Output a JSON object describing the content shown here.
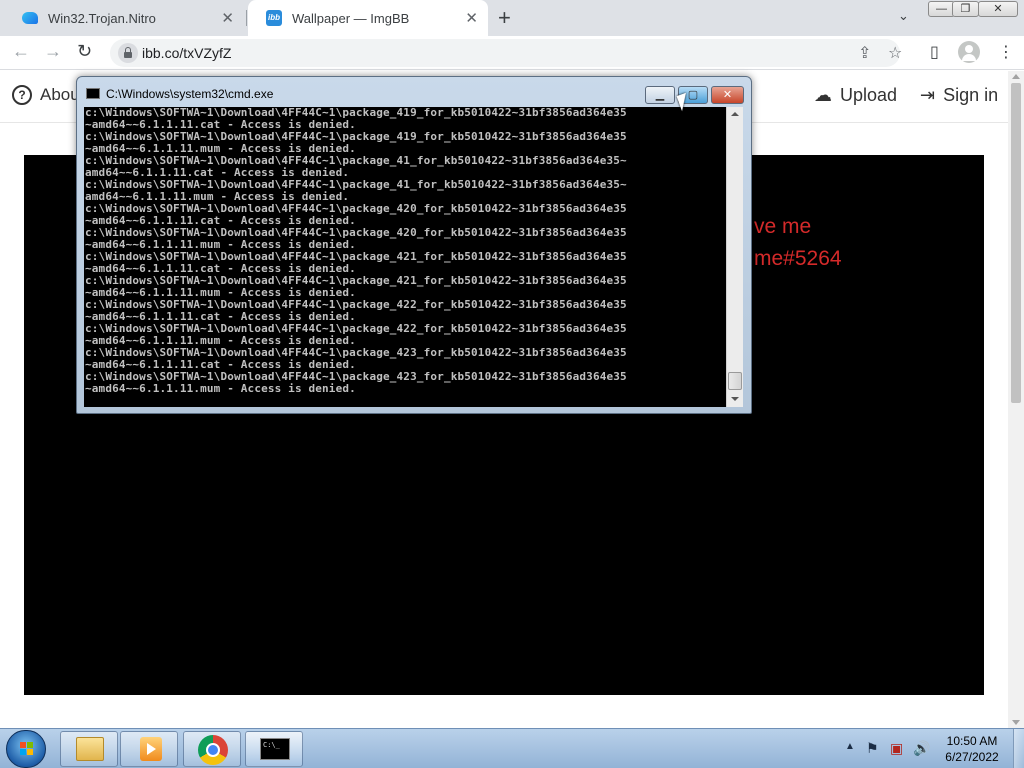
{
  "browser": {
    "tabs": [
      {
        "title": "Win32.Trojan.Nitro",
        "close": "✕",
        "active": false
      },
      {
        "title": "Wallpaper — ImgBB",
        "close": "✕",
        "active": true
      }
    ],
    "new_tab": "+",
    "tab_search": "⌄",
    "window_controls": {
      "minimize": "—",
      "maximize": "❐",
      "close": "✕"
    },
    "nav": {
      "back": "←",
      "forward": "→",
      "reload": "↻"
    },
    "url": "ibb.co/txVZyfZ",
    "toolbar_icons": {
      "share": "⇪",
      "bookmark": "☆",
      "sidebar": "▯",
      "menu": "⋮"
    }
  },
  "site": {
    "about_label": "About",
    "about_icon": "?",
    "upload_label": "Upload",
    "upload_icon": "☁",
    "signin_label": "Sign in",
    "signin_icon": "⇥"
  },
  "wallpaper": {
    "line1": "ve me",
    "line2": "me#5264",
    "text_color": "#d42a2a"
  },
  "cmd": {
    "title": "C:\\Windows\\system32\\cmd.exe",
    "controls": {
      "minimize": "▁",
      "maximize": "▢",
      "close": "✕"
    },
    "lines": [
      "c:\\Windows\\SOFTWA~1\\Download\\4FF44C~1\\package_419_for_kb5010422~31bf3856ad364e35",
      "~amd64~~6.1.1.11.cat - Access is denied.",
      "c:\\Windows\\SOFTWA~1\\Download\\4FF44C~1\\package_419_for_kb5010422~31bf3856ad364e35",
      "~amd64~~6.1.1.11.mum - Access is denied.",
      "c:\\Windows\\SOFTWA~1\\Download\\4FF44C~1\\package_41_for_kb5010422~31bf3856ad364e35~",
      "amd64~~6.1.1.11.cat - Access is denied.",
      "c:\\Windows\\SOFTWA~1\\Download\\4FF44C~1\\package_41_for_kb5010422~31bf3856ad364e35~",
      "amd64~~6.1.1.11.mum - Access is denied.",
      "c:\\Windows\\SOFTWA~1\\Download\\4FF44C~1\\package_420_for_kb5010422~31bf3856ad364e35",
      "~amd64~~6.1.1.11.cat - Access is denied.",
      "c:\\Windows\\SOFTWA~1\\Download\\4FF44C~1\\package_420_for_kb5010422~31bf3856ad364e35",
      "~amd64~~6.1.1.11.mum - Access is denied.",
      "c:\\Windows\\SOFTWA~1\\Download\\4FF44C~1\\package_421_for_kb5010422~31bf3856ad364e35",
      "~amd64~~6.1.1.11.cat - Access is denied.",
      "c:\\Windows\\SOFTWA~1\\Download\\4FF44C~1\\package_421_for_kb5010422~31bf3856ad364e35",
      "~amd64~~6.1.1.11.mum - Access is denied.",
      "c:\\Windows\\SOFTWA~1\\Download\\4FF44C~1\\package_422_for_kb5010422~31bf3856ad364e35",
      "~amd64~~6.1.1.11.cat - Access is denied.",
      "c:\\Windows\\SOFTWA~1\\Download\\4FF44C~1\\package_422_for_kb5010422~31bf3856ad364e35",
      "~amd64~~6.1.1.11.mum - Access is denied.",
      "c:\\Windows\\SOFTWA~1\\Download\\4FF44C~1\\package_423_for_kb5010422~31bf3856ad364e35",
      "~amd64~~6.1.1.11.cat - Access is denied.",
      "c:\\Windows\\SOFTWA~1\\Download\\4FF44C~1\\package_423_for_kb5010422~31bf3856ad364e35",
      "~amd64~~6.1.1.11.mum - Access is denied."
    ]
  },
  "taskbar": {
    "cmd_icon_text": "C:\\_",
    "tray": {
      "chevron": "▲",
      "action_center": "⚑",
      "network": "▣",
      "volume": "🔊"
    },
    "clock": {
      "time": "10:50 AM",
      "date": "6/27/2022"
    }
  },
  "colors": {
    "taskbar": "#a6c2e2",
    "console_text": "#c0c0c0",
    "console_bg": "#000000"
  }
}
